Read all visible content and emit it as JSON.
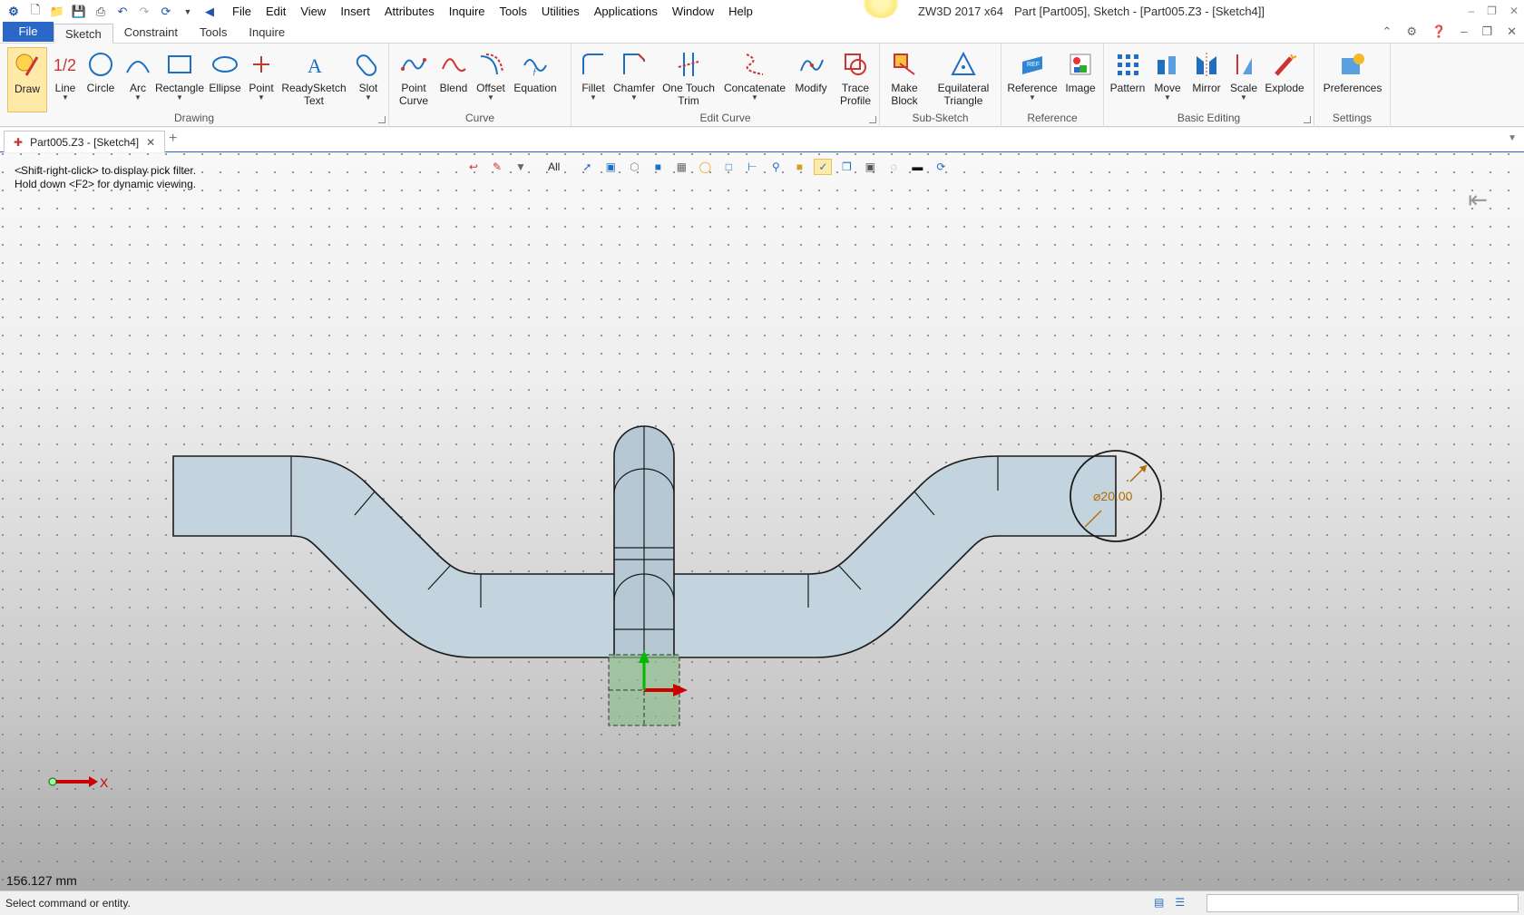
{
  "titlebar": {
    "app": "ZW3D 2017  x64",
    "document": "Part [Part005],  Sketch - [Part005.Z3 - [Sketch4]]",
    "menus": [
      "File",
      "Edit",
      "View",
      "Insert",
      "Attributes",
      "Inquire",
      "Tools",
      "Utilities",
      "Applications",
      "Window",
      "Help"
    ]
  },
  "ribbon_tabs": {
    "file": "File",
    "tabs": [
      "Sketch",
      "Constraint",
      "Tools",
      "Inquire"
    ],
    "active": "Sketch"
  },
  "ribbon": {
    "drawing": {
      "label": "Drawing",
      "buttons": [
        "Draw",
        "Line",
        "Circle",
        "Arc",
        "Rectangle",
        "Ellipse",
        "Point",
        "ReadySketch\nText",
        "Slot"
      ]
    },
    "curve": {
      "label": "Curve",
      "buttons": [
        "Point\nCurve",
        "Blend",
        "Offset",
        "Equation"
      ]
    },
    "edit_curve": {
      "label": "Edit Curve",
      "buttons": [
        "Fillet",
        "Chamfer",
        "One Touch\nTrim",
        "Concatenate",
        "Modify",
        "Trace\nProfile"
      ]
    },
    "sub_sketch": {
      "label": "Sub-Sketch",
      "buttons": [
        "Make\nBlock",
        "Equilateral\nTriangle"
      ]
    },
    "reference": {
      "label": "Reference",
      "buttons": [
        "Reference",
        "Image"
      ]
    },
    "basic_editing": {
      "label": "Basic Editing",
      "buttons": [
        "Pattern",
        "Move",
        "Mirror",
        "Scale",
        "Explode"
      ]
    },
    "settings": {
      "label": "Settings",
      "buttons": [
        "Preferences"
      ]
    }
  },
  "doc_tab": {
    "label": "Part005.Z3 - [Sketch4]"
  },
  "viewport": {
    "filter": "All",
    "hints": [
      "<Shift-right-click> to display pick filter.",
      "Hold down <F2> for dynamic viewing."
    ],
    "dimension": "⌀20.00",
    "axis_label": "X",
    "measurement": "156.127 mm"
  },
  "status": {
    "text": "Select command or entity."
  },
  "colors": {
    "accent": "#2b67c7",
    "pipe": "#c3d4df",
    "dimension": "#b26b00",
    "origin": "#8fbf8f"
  }
}
